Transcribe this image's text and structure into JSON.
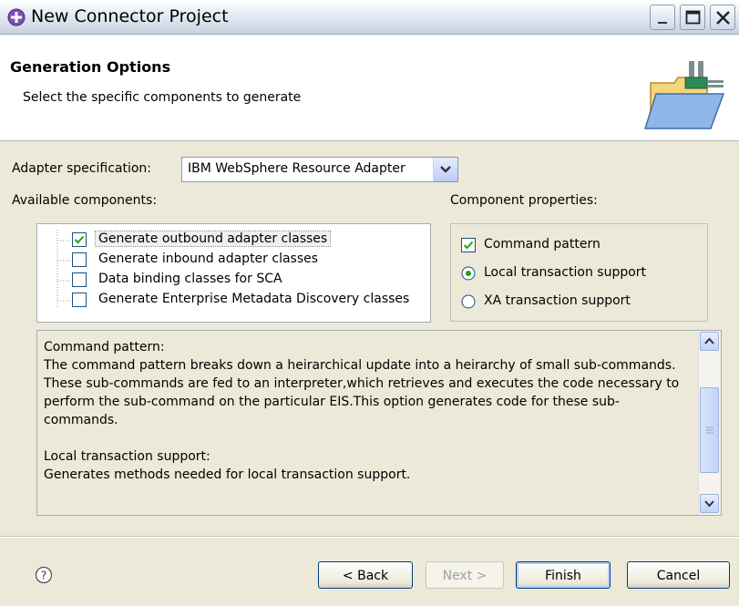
{
  "window": {
    "title": "New Connector Project"
  },
  "header": {
    "title": "Generation Options",
    "description": "Select the specific components to generate"
  },
  "adapter_spec": {
    "label": "Adapter specification:",
    "value": "IBM WebSphere Resource Adapter"
  },
  "available": {
    "label": "Available components:",
    "items": [
      {
        "label": "Generate outbound adapter classes",
        "checked": true
      },
      {
        "label": "Generate inbound adapter classes",
        "checked": false
      },
      {
        "label": "Data binding classes for SCA",
        "checked": false
      },
      {
        "label": "Generate Enterprise Metadata Discovery classes",
        "checked": false
      }
    ]
  },
  "properties": {
    "label": "Component properties:",
    "command_pattern": "Command pattern",
    "local_transaction": "Local transaction support",
    "xa_transaction": "XA transaction support",
    "selected_transaction": "Local transaction support"
  },
  "description": {
    "text": "Command pattern:\nThe command pattern breaks down a heirarchical update into a heirarchy of small sub-commands.  These sub-commands are fed to an interpreter,which retrieves and executes the code necessary to perform the sub-command on the particular EIS.This option generates code for these sub-commands.\n\nLocal transaction support:\nGenerates methods needed for local transaction support."
  },
  "buttons": {
    "back": "< Back",
    "next": "Next >",
    "finish": "Finish",
    "cancel": "Cancel"
  },
  "icons": {
    "app": "connector-project-icon",
    "help": "help-icon",
    "header_graphic": "folder-connector-icon"
  }
}
